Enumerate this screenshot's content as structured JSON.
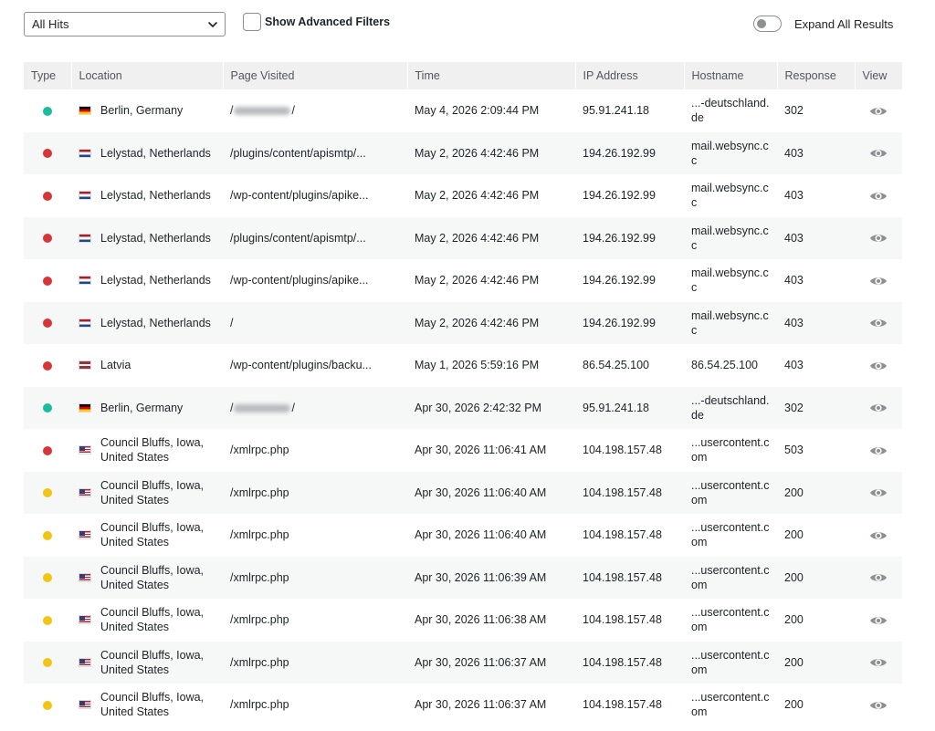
{
  "toolbar": {
    "filter_select": {
      "value": "All Hits"
    },
    "advanced_filters_label": "Show Advanced Filters",
    "expand_all_label": "Expand All Results"
  },
  "table": {
    "headers": [
      "Type",
      "Location",
      "Page Visited",
      "Time",
      "IP Address",
      "Hostname",
      "Response",
      "View"
    ],
    "rows": [
      {
        "type": "green",
        "flag": "de",
        "location": "Berlin, Germany",
        "page": "/",
        "page_suffix": "/",
        "page_redacted": true,
        "time": "May 4, 2026 2:09:44 PM",
        "ip": "95.91.241.18",
        "hostname": "...-deutschland.de",
        "response": "302"
      },
      {
        "type": "red",
        "flag": "nl",
        "location": "Lelystad, Netherlands",
        "page": "/plugins/content/apismtp/...",
        "time": "May 2, 2026 4:42:46 PM",
        "ip": "194.26.192.99",
        "hostname": "mail.websync.cc",
        "response": "403"
      },
      {
        "type": "red",
        "flag": "nl",
        "location": "Lelystad, Netherlands",
        "page": "/wp-content/plugins/apike...",
        "time": "May 2, 2026 4:42:46 PM",
        "ip": "194.26.192.99",
        "hostname": "mail.websync.cc",
        "response": "403"
      },
      {
        "type": "red",
        "flag": "nl",
        "location": "Lelystad, Netherlands",
        "page": "/plugins/content/apismtp/...",
        "time": "May 2, 2026 4:42:46 PM",
        "ip": "194.26.192.99",
        "hostname": "mail.websync.cc",
        "response": "403"
      },
      {
        "type": "red",
        "flag": "nl",
        "location": "Lelystad, Netherlands",
        "page": "/wp-content/plugins/apike...",
        "time": "May 2, 2026 4:42:46 PM",
        "ip": "194.26.192.99",
        "hostname": "mail.websync.cc",
        "response": "403"
      },
      {
        "type": "red",
        "flag": "nl",
        "location": "Lelystad, Netherlands",
        "page": "/",
        "time": "May 2, 2026 4:42:46 PM",
        "ip": "194.26.192.99",
        "hostname": "mail.websync.cc",
        "response": "403"
      },
      {
        "type": "red",
        "flag": "lv",
        "location": "Latvia",
        "page": "/wp-content/plugins/backu...",
        "time": "May 1, 2026 5:59:16 PM",
        "ip": "86.54.25.100",
        "hostname": "86.54.25.100",
        "response": "403"
      },
      {
        "type": "green",
        "flag": "de",
        "location": "Berlin, Germany",
        "page": "/",
        "page_suffix": "/",
        "page_redacted": true,
        "time": "Apr 30, 2026 2:42:32 PM",
        "ip": "95.91.241.18",
        "hostname": "...-deutschland.de",
        "response": "302"
      },
      {
        "type": "red",
        "flag": "us",
        "location": "Council Bluffs, Iowa, United States",
        "page": "/xmlrpc.php",
        "time": "Apr 30, 2026 11:06:41 AM",
        "ip": "104.198.157.48",
        "hostname": "...usercontent.com",
        "response": "503"
      },
      {
        "type": "yellow",
        "flag": "us",
        "location": "Council Bluffs, Iowa, United States",
        "page": "/xmlrpc.php",
        "time": "Apr 30, 2026 11:06:40 AM",
        "ip": "104.198.157.48",
        "hostname": "...usercontent.com",
        "response": "200"
      },
      {
        "type": "yellow",
        "flag": "us",
        "location": "Council Bluffs, Iowa, United States",
        "page": "/xmlrpc.php",
        "time": "Apr 30, 2026 11:06:40 AM",
        "ip": "104.198.157.48",
        "hostname": "...usercontent.com",
        "response": "200"
      },
      {
        "type": "yellow",
        "flag": "us",
        "location": "Council Bluffs, Iowa, United States",
        "page": "/xmlrpc.php",
        "time": "Apr 30, 2026 11:06:39 AM",
        "ip": "104.198.157.48",
        "hostname": "...usercontent.com",
        "response": "200"
      },
      {
        "type": "yellow",
        "flag": "us",
        "location": "Council Bluffs, Iowa, United States",
        "page": "/xmlrpc.php",
        "time": "Apr 30, 2026 11:06:38 AM",
        "ip": "104.198.157.48",
        "hostname": "...usercontent.com",
        "response": "200"
      },
      {
        "type": "yellow",
        "flag": "us",
        "location": "Council Bluffs, Iowa, United States",
        "page": "/xmlrpc.php",
        "time": "Apr 30, 2026 11:06:37 AM",
        "ip": "104.198.157.48",
        "hostname": "...usercontent.com",
        "response": "200"
      },
      {
        "type": "yellow",
        "flag": "us",
        "location": "Council Bluffs, Iowa, United States",
        "page": "/xmlrpc.php",
        "time": "Apr 30, 2026 11:06:37 AM",
        "ip": "104.198.157.48",
        "hostname": "...usercontent.com",
        "response": "200"
      }
    ]
  },
  "colors": {
    "green": "#1abc9c",
    "red": "#d63638",
    "yellow": "#f0c514",
    "header_bg": "#f0f0f1",
    "stripe_bg": "#f6f7f7",
    "eye_icon": "#8c8f94"
  },
  "icons": {
    "dropdown": "chevron-down-icon",
    "view": "eye-icon",
    "type": "status-dot-icon"
  }
}
